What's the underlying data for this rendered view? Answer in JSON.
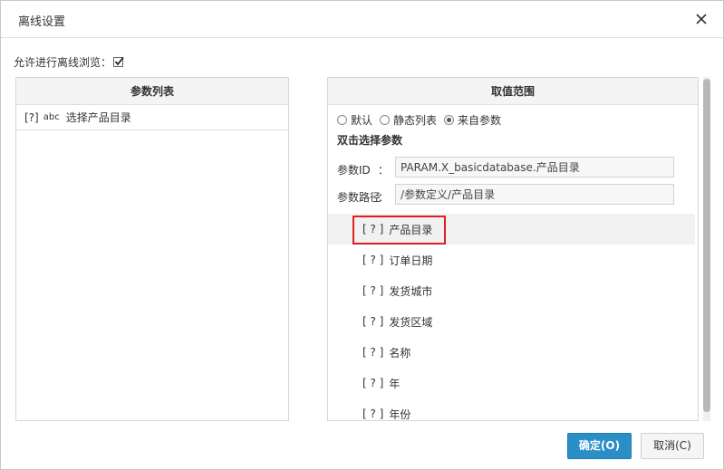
{
  "dialog": {
    "title": "离线设置",
    "allow_offline_label": "允许进行离线浏览：",
    "allow_offline_checked": true
  },
  "left_panel": {
    "header": "参数列表",
    "items": [
      {
        "qmark": "[?]",
        "type": "abc",
        "label": "选择产品目录"
      }
    ]
  },
  "right_panel": {
    "header": "取值范围",
    "radios": [
      {
        "label": "默认",
        "checked": false
      },
      {
        "label": "静态列表",
        "checked": false
      },
      {
        "label": "来自参数",
        "checked": true
      }
    ],
    "dbl_click_title": "双击选择参数",
    "param_id_label": "参数ID",
    "param_id_colon": "：",
    "param_id_value": "PARAM.X_basicdatabase.产品目录",
    "param_path_label": "参数路径",
    "param_path_colon": "：",
    "param_path_value": "/参数定义/产品目录",
    "params": [
      {
        "bracket": "[ ? ]",
        "name": "产品目录"
      },
      {
        "bracket": "[ ? ]",
        "name": "订单日期"
      },
      {
        "bracket": "[ ? ]",
        "name": "发货城市"
      },
      {
        "bracket": "[ ? ]",
        "name": "发货区域"
      },
      {
        "bracket": "[ ? ]",
        "name": "名称"
      },
      {
        "bracket": "[ ? ]",
        "name": "年"
      },
      {
        "bracket": "[ ? ]",
        "name": "年份"
      }
    ]
  },
  "buttons": {
    "ok": "确定(O)",
    "cancel": "取消(C)"
  },
  "colors": {
    "primary": "#2b8fc7",
    "highlight_border": "#e02020"
  }
}
